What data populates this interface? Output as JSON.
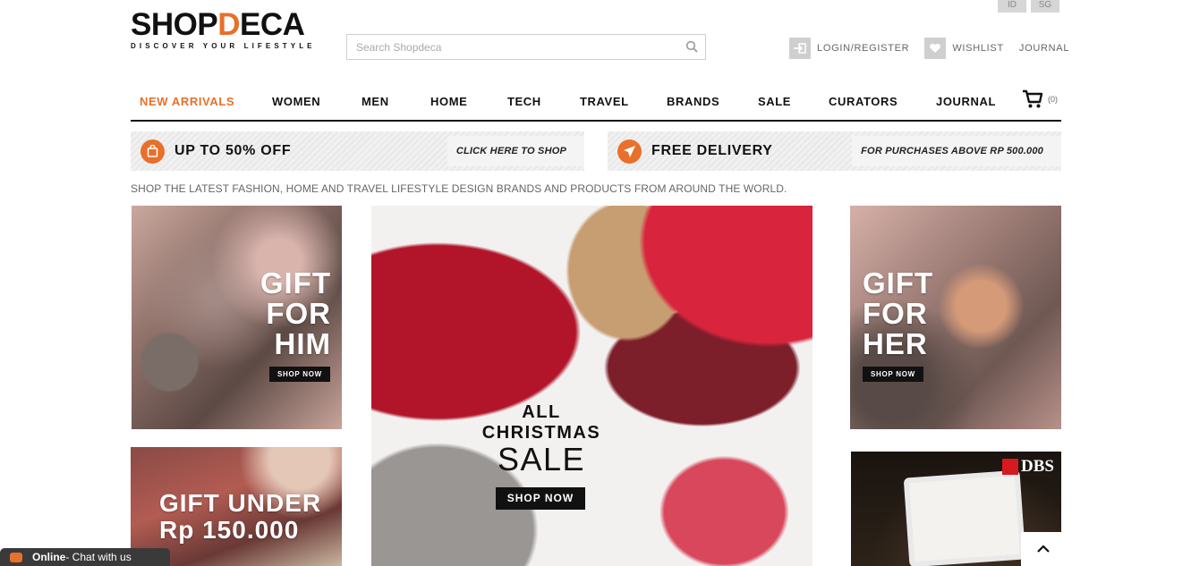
{
  "lang": {
    "id": "ID",
    "sg": "SG"
  },
  "logo": {
    "main_pre": "SHOP",
    "main_d": "D",
    "main_post": "ECA",
    "tagline": "DISCOVER YOUR LIFESTYLE"
  },
  "search": {
    "placeholder": "Search Shopdeca",
    "icon": "search-icon"
  },
  "toplinks": {
    "login": "LOGIN/REGISTER",
    "wishlist": "WISHLIST",
    "journal": "JOURNAL"
  },
  "nav": {
    "items": [
      "NEW ARRIVALS",
      "WOMEN",
      "MEN",
      "HOME",
      "TECH",
      "TRAVEL",
      "BRANDS",
      "SALE",
      "CURATORS",
      "JOURNAL"
    ],
    "cart_count": "(0)"
  },
  "promos": {
    "discount": {
      "title": "UP TO 50% OFF",
      "cta": "CLICK HERE TO SHOP"
    },
    "delivery": {
      "title": "FREE DELIVERY",
      "cta": "FOR PURCHASES ABOVE RP 500.000"
    }
  },
  "tagline": "SHOP THE LATEST FASHION, HOME AND TRAVEL LIFESTYLE DESIGN BRANDS AND PRODUCTS FROM AROUND THE WORLD.",
  "tiles": {
    "him": {
      "l1": "GIFT",
      "l2": "FOR",
      "l3": "HIM",
      "button": "SHOP NOW"
    },
    "her": {
      "l1": "GIFT",
      "l2": "FOR",
      "l3": "HER",
      "button": "SHOP NOW"
    },
    "under": {
      "l1": "GIFT UNDER",
      "l2": "Rp 150.000"
    },
    "main": {
      "l1": "ALL",
      "l2": "CHRISTMAS",
      "l3": "SALE",
      "button": "SHOP NOW"
    },
    "dbs": {
      "brand": "DBS"
    }
  },
  "chat": {
    "status": "Online",
    "text": " - Chat with us"
  },
  "colors": {
    "accent": "#e8702b",
    "dark": "#111111",
    "stripe": "#efefef"
  }
}
